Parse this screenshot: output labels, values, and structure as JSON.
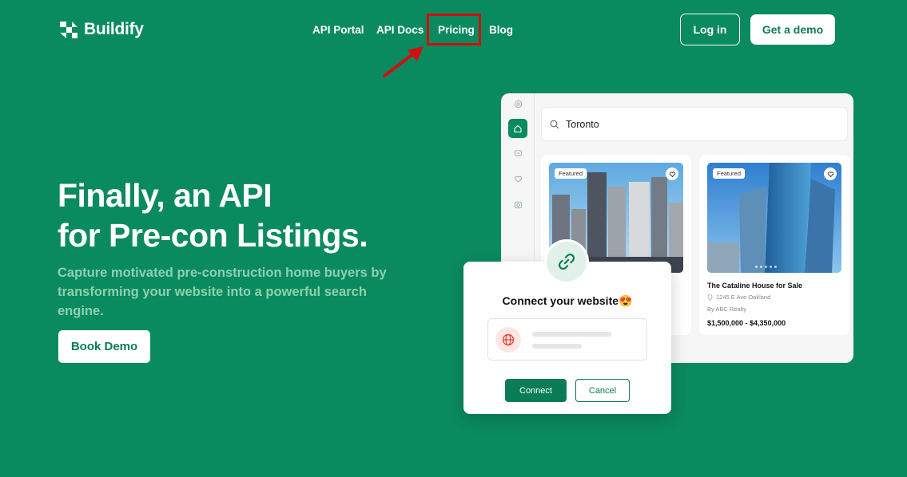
{
  "brand": {
    "name": "Buildify"
  },
  "nav": {
    "items": [
      "API Portal",
      "API Docs",
      "Pricing",
      "Blog"
    ]
  },
  "header": {
    "login_label": "Log in",
    "demo_label": "Get a demo"
  },
  "hero": {
    "title_line1": "Finally, an API",
    "title_line2": "for Pre-con Listings.",
    "subtitle": "Capture motivated pre-construction home buyers by transforming your website into a powerful search engine.",
    "cta_label": "Book Demo"
  },
  "mockup": {
    "search_value": "Toronto",
    "cards": [
      {
        "badge": "Featured"
      },
      {
        "badge": "Featured",
        "title": "The Cataline House for Sale",
        "address": "1245 E Ave Oakland",
        "by": "By ABC Realty",
        "price": "$1,500,000 - $4,350,000"
      }
    ]
  },
  "dialog": {
    "title": "Connect your website😍",
    "connect_label": "Connect",
    "cancel_label": "Cancel"
  },
  "colors": {
    "background": "#0a8a5f",
    "accent": "#0a7c56",
    "highlight": "#d10f0f"
  }
}
